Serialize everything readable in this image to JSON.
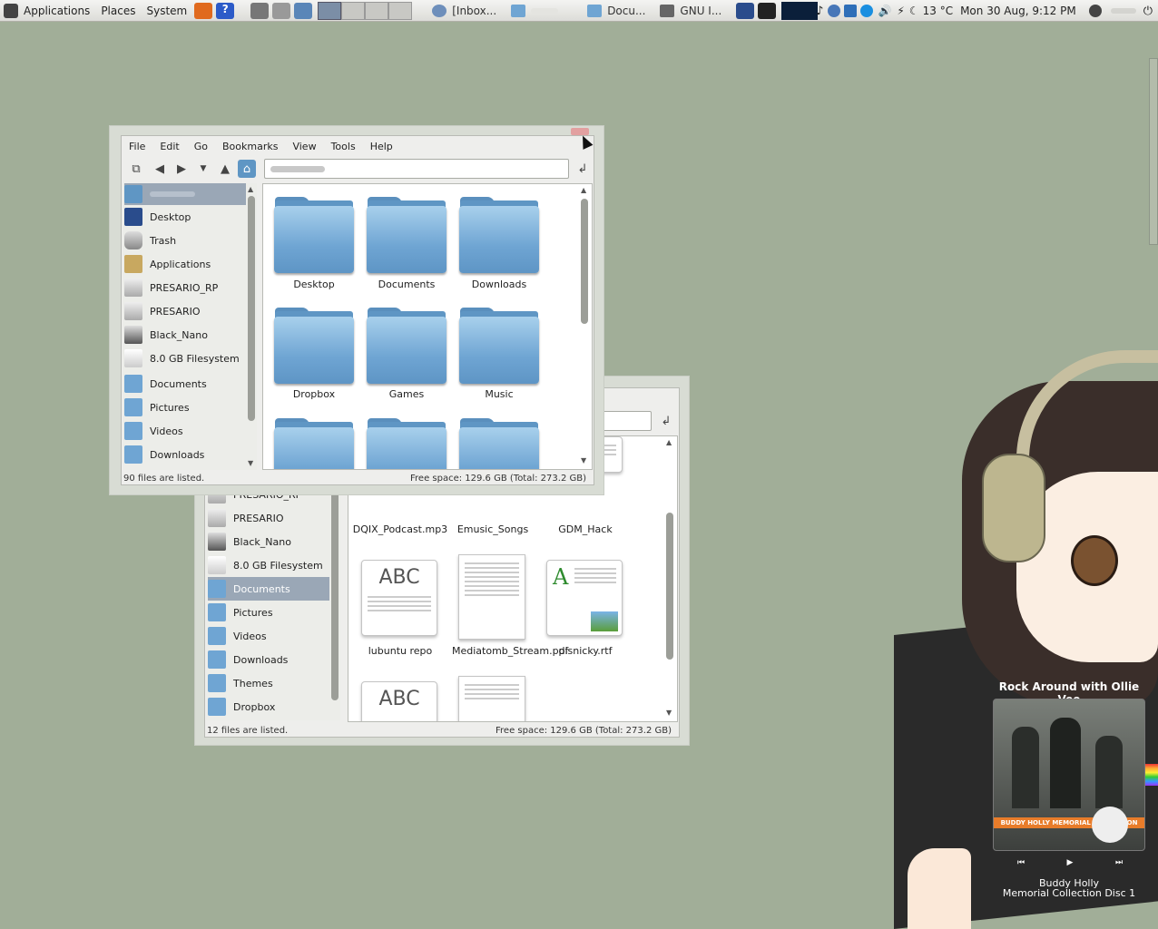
{
  "panel": {
    "menus": [
      "Applications",
      "Places",
      "System"
    ],
    "tasks": [
      {
        "label": "[Inbox...",
        "icon": "mail-icon"
      },
      {
        "label": "",
        "icon": "folder-icon"
      },
      {
        "label": "Docu...",
        "icon": "folder-icon"
      },
      {
        "label": "GNU I...",
        "icon": "gimp-icon"
      }
    ],
    "temperature": "13 °C",
    "clock": "Mon 30 Aug,  9:12 PM"
  },
  "front_window": {
    "menu": [
      "File",
      "Edit",
      "Go",
      "Bookmarks",
      "View",
      "Tools",
      "Help"
    ],
    "sidebar": [
      {
        "label": "",
        "icon": "home-icon",
        "selected": true
      },
      {
        "label": "Desktop",
        "icon": "desktop-icon"
      },
      {
        "label": "Trash",
        "icon": "trash-icon"
      },
      {
        "label": "Applications",
        "icon": "applications-icon"
      },
      {
        "label": "PRESARIO_RP",
        "icon": "drive-icon"
      },
      {
        "label": "PRESARIO",
        "icon": "drive-icon"
      },
      {
        "label": "Black_Nano",
        "icon": "ipod-icon"
      },
      {
        "label": "8.0 GB Filesystem",
        "icon": "usb-icon"
      },
      {
        "label": "Documents",
        "icon": "folder-icon"
      },
      {
        "label": "Pictures",
        "icon": "folder-icon"
      },
      {
        "label": "Videos",
        "icon": "folder-icon"
      },
      {
        "label": "Downloads",
        "icon": "folder-icon"
      }
    ],
    "folders": [
      "Desktop",
      "Documents",
      "Downloads",
      "Dropbox",
      "Games",
      "Music",
      "",
      "",
      ""
    ],
    "status_left": "90 files are listed.",
    "status_right": "Free space: 129.6 GB (Total: 273.2 GB)"
  },
  "back_window": {
    "sidebar": [
      {
        "label": "PRESARIO_RP",
        "icon": "drive-icon"
      },
      {
        "label": "PRESARIO",
        "icon": "drive-icon"
      },
      {
        "label": "Black_Nano",
        "icon": "ipod-icon"
      },
      {
        "label": "8.0 GB Filesystem",
        "icon": "usb-icon"
      },
      {
        "label": "Documents",
        "icon": "folder-icon",
        "selected": true
      },
      {
        "label": "Pictures",
        "icon": "folder-icon"
      },
      {
        "label": "Videos",
        "icon": "folder-icon"
      },
      {
        "label": "Downloads",
        "icon": "folder-icon"
      },
      {
        "label": "Themes",
        "icon": "folder-icon"
      },
      {
        "label": "Dropbox",
        "icon": "folder-icon"
      }
    ],
    "files": [
      {
        "label": "DQIX_Podcast.mp3",
        "thumb": "mp3"
      },
      {
        "label": "Emusic_Songs",
        "thumb": "doc"
      },
      {
        "label": "GDM_Hack",
        "thumb": "abc"
      },
      {
        "label": "lubuntu repo",
        "thumb": "abc"
      },
      {
        "label": "Mediatomb_Stream.pdf",
        "thumb": "pdf"
      },
      {
        "label": "pisnicky.rtf",
        "thumb": "rtf"
      },
      {
        "label": "",
        "thumb": "abc"
      },
      {
        "label": "",
        "thumb": "pdf"
      }
    ],
    "status_left": "12 files are listed.",
    "status_right": "Free space: 129.6 GB (Total: 273.2 GB)"
  },
  "player": {
    "title": "Rock Around with Ollie Vee",
    "cover_band": "BUDDY HOLLY MEMORIAL COLLECTION",
    "artist": "Buddy Holly",
    "album": "Memorial Collection Disc 1",
    "controls": [
      "previous",
      "play",
      "next"
    ]
  }
}
